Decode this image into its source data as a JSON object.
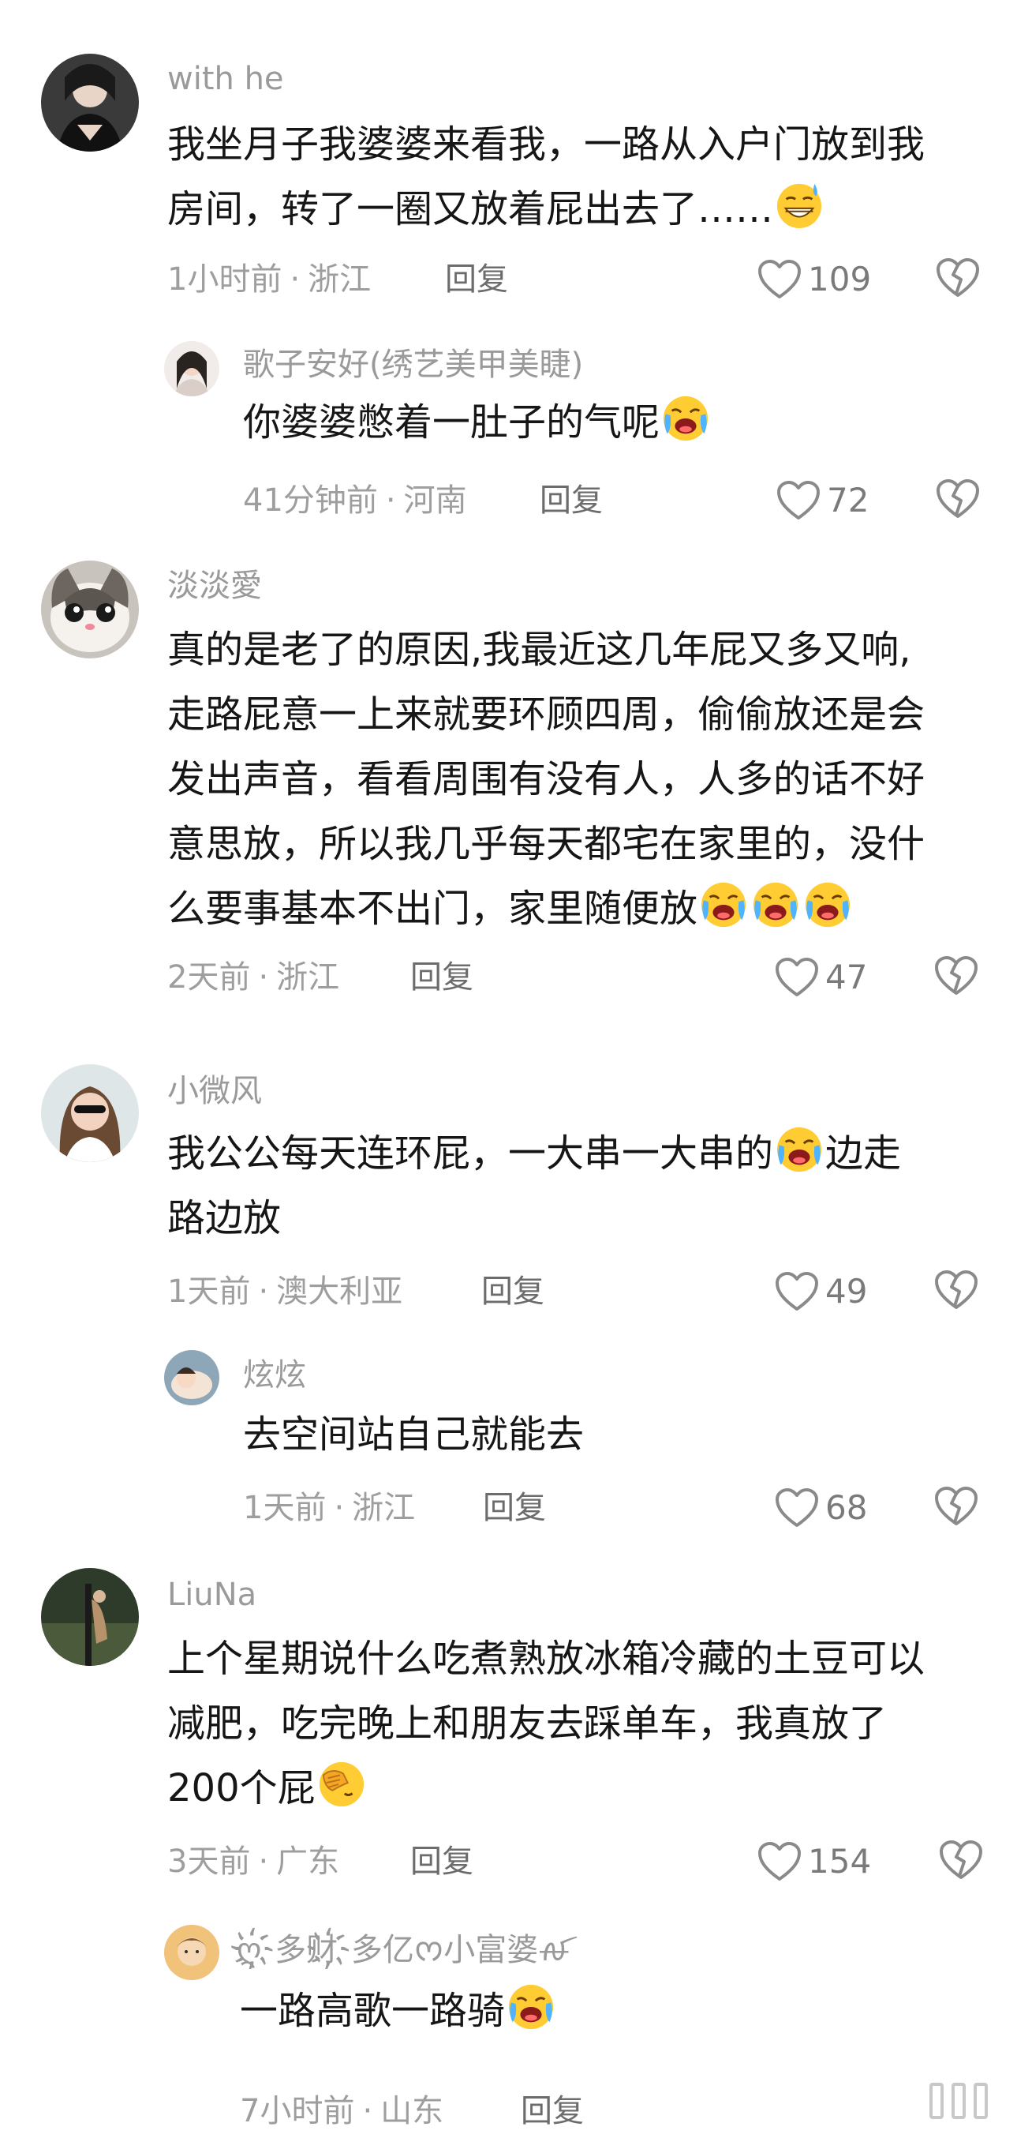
{
  "comments": [
    {
      "username": "with he",
      "text": "我坐月子我婆婆来看我，一路从入户门放到我\n房间，转了一圈又放着屁出去了……",
      "time": "1小时前",
      "location": "浙江",
      "reply": "回复",
      "likes": "109"
    },
    {
      "username": "歌子安好(绣艺美甲美睫)",
      "text": "你婆婆憋着一肚子的气呢",
      "time": "41分钟前",
      "location": "河南",
      "reply": "回复",
      "likes": "72"
    },
    {
      "username": "淡淡愛",
      "text": "真的是老了的原因,我最近这几年屁又多又响,\n走路屁意一上来就要环顾四周，偷偷放还是会\n发出声音，看看周围有没有人，人多的话不好\n意思放，所以我几乎每天都宅在家里的，没什\n么要事基本不出门，家里随便放",
      "time": "2天前",
      "location": "浙江",
      "reply": "回复",
      "likes": "47"
    },
    {
      "username": "小微风",
      "text_a": "我公公每天连环屁，一大串一大串的",
      "text_b": "边走\n路边放",
      "time": "1天前",
      "location": "澳大利亚",
      "reply": "回复",
      "likes": "49"
    },
    {
      "username": "炫炫",
      "text": "去空间站自己就能去",
      "time": "1天前",
      "location": "浙江",
      "reply": "回复",
      "likes": "68"
    },
    {
      "username": "LiuNa",
      "text": "上个星期说什么吃煮熟放冰箱冷藏的土豆可以\n减肥，吃完晚上和朋友去踩单车，我真放了\n200个屁",
      "time": "3天前",
      "location": "广东",
      "reply": "回复",
      "likes": "154"
    },
    {
      "username": "ღ҉多财҉多亿ᰔ小富婆ꫛ",
      "text": "一路高歌一路骑",
      "time": "7小时前",
      "location": "山东",
      "reply": "回复",
      "likes": ""
    }
  ],
  "separator": "·",
  "icons": {
    "like": "heart-outline-icon",
    "dislike": "broken-heart-icon",
    "emoji_sweat": "grinning-sweat-emoji",
    "emoji_cry": "loudly-crying-emoji",
    "emoji_facepalm": "facepalm-emoji"
  }
}
